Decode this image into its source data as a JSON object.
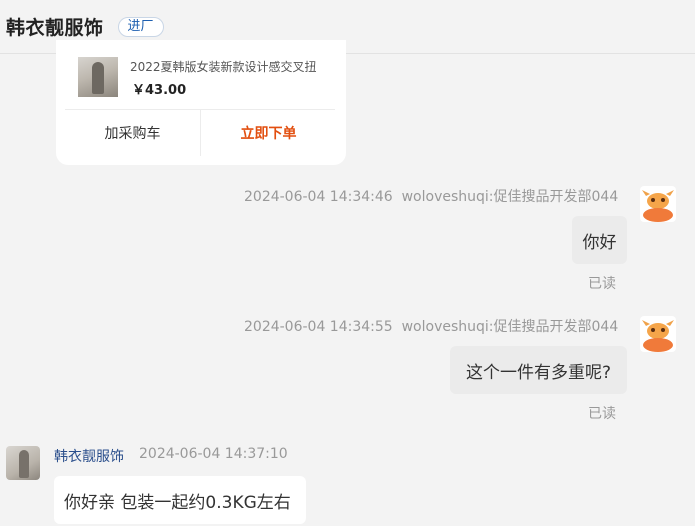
{
  "header": {
    "shop_name": "韩衣靓服饰",
    "badge": "进厂"
  },
  "product": {
    "name": "2022夏韩版女装新款设计感交叉扭",
    "price": "￥43.00",
    "add_to_cart": "加采购车",
    "order_now": "立即下单"
  },
  "messages": [
    {
      "time": "2024-06-04 14:34:46",
      "sender": "woloveshuqi:促佳搜品开发部044",
      "text": "你好",
      "status": "已读"
    },
    {
      "time": "2024-06-04 14:34:55",
      "sender": "woloveshuqi:促佳搜品开发部044",
      "text": "这个一件有多重呢?",
      "status": "已读"
    },
    {
      "sender": "韩衣靓服饰",
      "time": "2024-06-04 14:37:10",
      "text": "你好亲  包装一起约0.3KG左右"
    }
  ],
  "icons": {
    "user_avatar": "bull-avatar-icon",
    "shop_avatar": "shop-avatar"
  },
  "colors": {
    "accent_order": "#e24f10",
    "sender_name": "#2b4f8c",
    "bull_orange": "#f07a3a"
  }
}
